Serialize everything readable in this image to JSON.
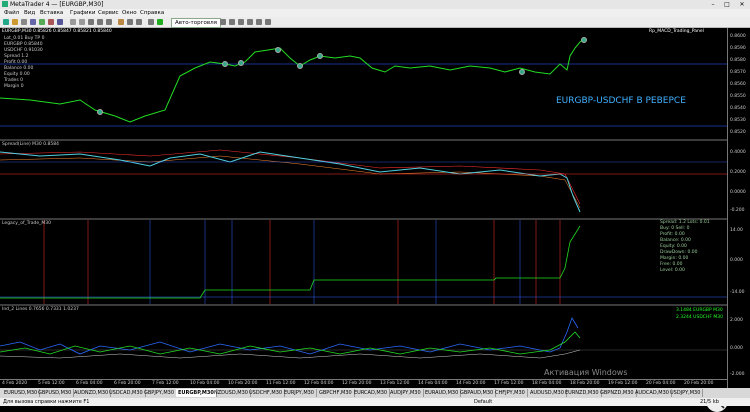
{
  "window": {
    "title": "MetaTrader 4 — [EURGBP,M30]",
    "minimize": "–",
    "maximize": "□",
    "close": "✕"
  },
  "menu": {
    "items": [
      "Файл",
      "Вид",
      "Вставка",
      "Графики",
      "Сервис",
      "Окно",
      "Справка"
    ]
  },
  "toolbar": {
    "autotrading_label": "Авто-торговля"
  },
  "overlay_text": "EURGBP-USDCHF В РЕВЕРСЕ",
  "watermark": "Активация Windows",
  "main_pane": {
    "symbol_line": "EURGBP,M30 0.85826 0.85847 0.85821 0.85840",
    "indicator_right": "Rp_MACD_Trading_Panel",
    "info_lines": [
      "Lot_0.01 Buy TP 0",
      "EURGBP 0.85840",
      "USDCHF 0.91030",
      "Spread 1.2",
      "Profit 0.00",
      "Balance 0.00",
      "Equity 0.00",
      "Trades 0",
      "Margin 0"
    ]
  },
  "pane2": {
    "label": "Spread(Line) M30  0.8584"
  },
  "pane3": {
    "label": "Legacy_of_Trade_M30",
    "stats": [
      "Spread: 1.2 Lots: 0.01",
      "Buy: 0 Sell: 0",
      "Profit: 0.00",
      "Balance: 0.00",
      "Equity: 0.00",
      "DrawDown: 0.00",
      "Margin: 0.00",
      "Free: 0.00",
      "Level: 0.00"
    ]
  },
  "pane4": {
    "label": "Ind_2 Lines 0.7656 0.7331 1.0237",
    "value1": "3.1484 EURGBP M30",
    "value2": "2.3244 USDCHF M30"
  },
  "price_axis": [
    "0.8600",
    "0.8590",
    "0.8580",
    "0.8570",
    "0.8560",
    "0.8550",
    "0.8540",
    "0.8530",
    "0.8520",
    "0.4000",
    "0.2000",
    "0.0000",
    "-0.200",
    "14.00",
    "0.000",
    "-14.00",
    "2.000",
    "0.000",
    "-2.000"
  ],
  "time_axis": [
    "4 Feb 2020",
    "5 Feb 12:00",
    "6 Feb 04:00",
    "6 Feb 20:00",
    "7 Feb 12:00",
    "10 Feb 04:00",
    "10 Feb 20:00",
    "11 Feb 12:00",
    "12 Feb 04:00",
    "12 Feb 20:00",
    "13 Feb 12:00",
    "14 Feb 04:00",
    "14 Feb 20:00",
    "17 Feb 12:00",
    "18 Feb 04:00",
    "18 Feb 20:00",
    "19 Feb 12:00",
    "20 Feb 04:00",
    "20 Feb 20:00"
  ],
  "tabs": [
    "EURUSD,M30",
    "GBPUSD,M30",
    "AUDNZD,M30",
    "USDCAD,M30",
    "GBPJPY,M30",
    "EURGBP,M30",
    "NZDUSD,M30",
    "USDCHF,M30",
    "EURJPY,M30",
    "GBPCHF,M30",
    "EURCAD,M30",
    "AUDJPY,M30",
    "EURAUD,M30",
    "GBPAUD,M30",
    "CHFJPY,M30",
    "AUDUSD,M30",
    "EURNZD,M30",
    "GBPNZD,M30",
    "AUDCAD,M30",
    "USDJPY,M30"
  ],
  "active_tab": 5,
  "status": {
    "help": "Для вызова справки нажмите F1",
    "profile": "Default",
    "size": "21/5 kb"
  },
  "colors": {
    "price": "#22dd22",
    "overlay": "#3fb1ff",
    "spread": "#4fd0e0",
    "red": "#ff3030",
    "blue": "#3060ff"
  }
}
